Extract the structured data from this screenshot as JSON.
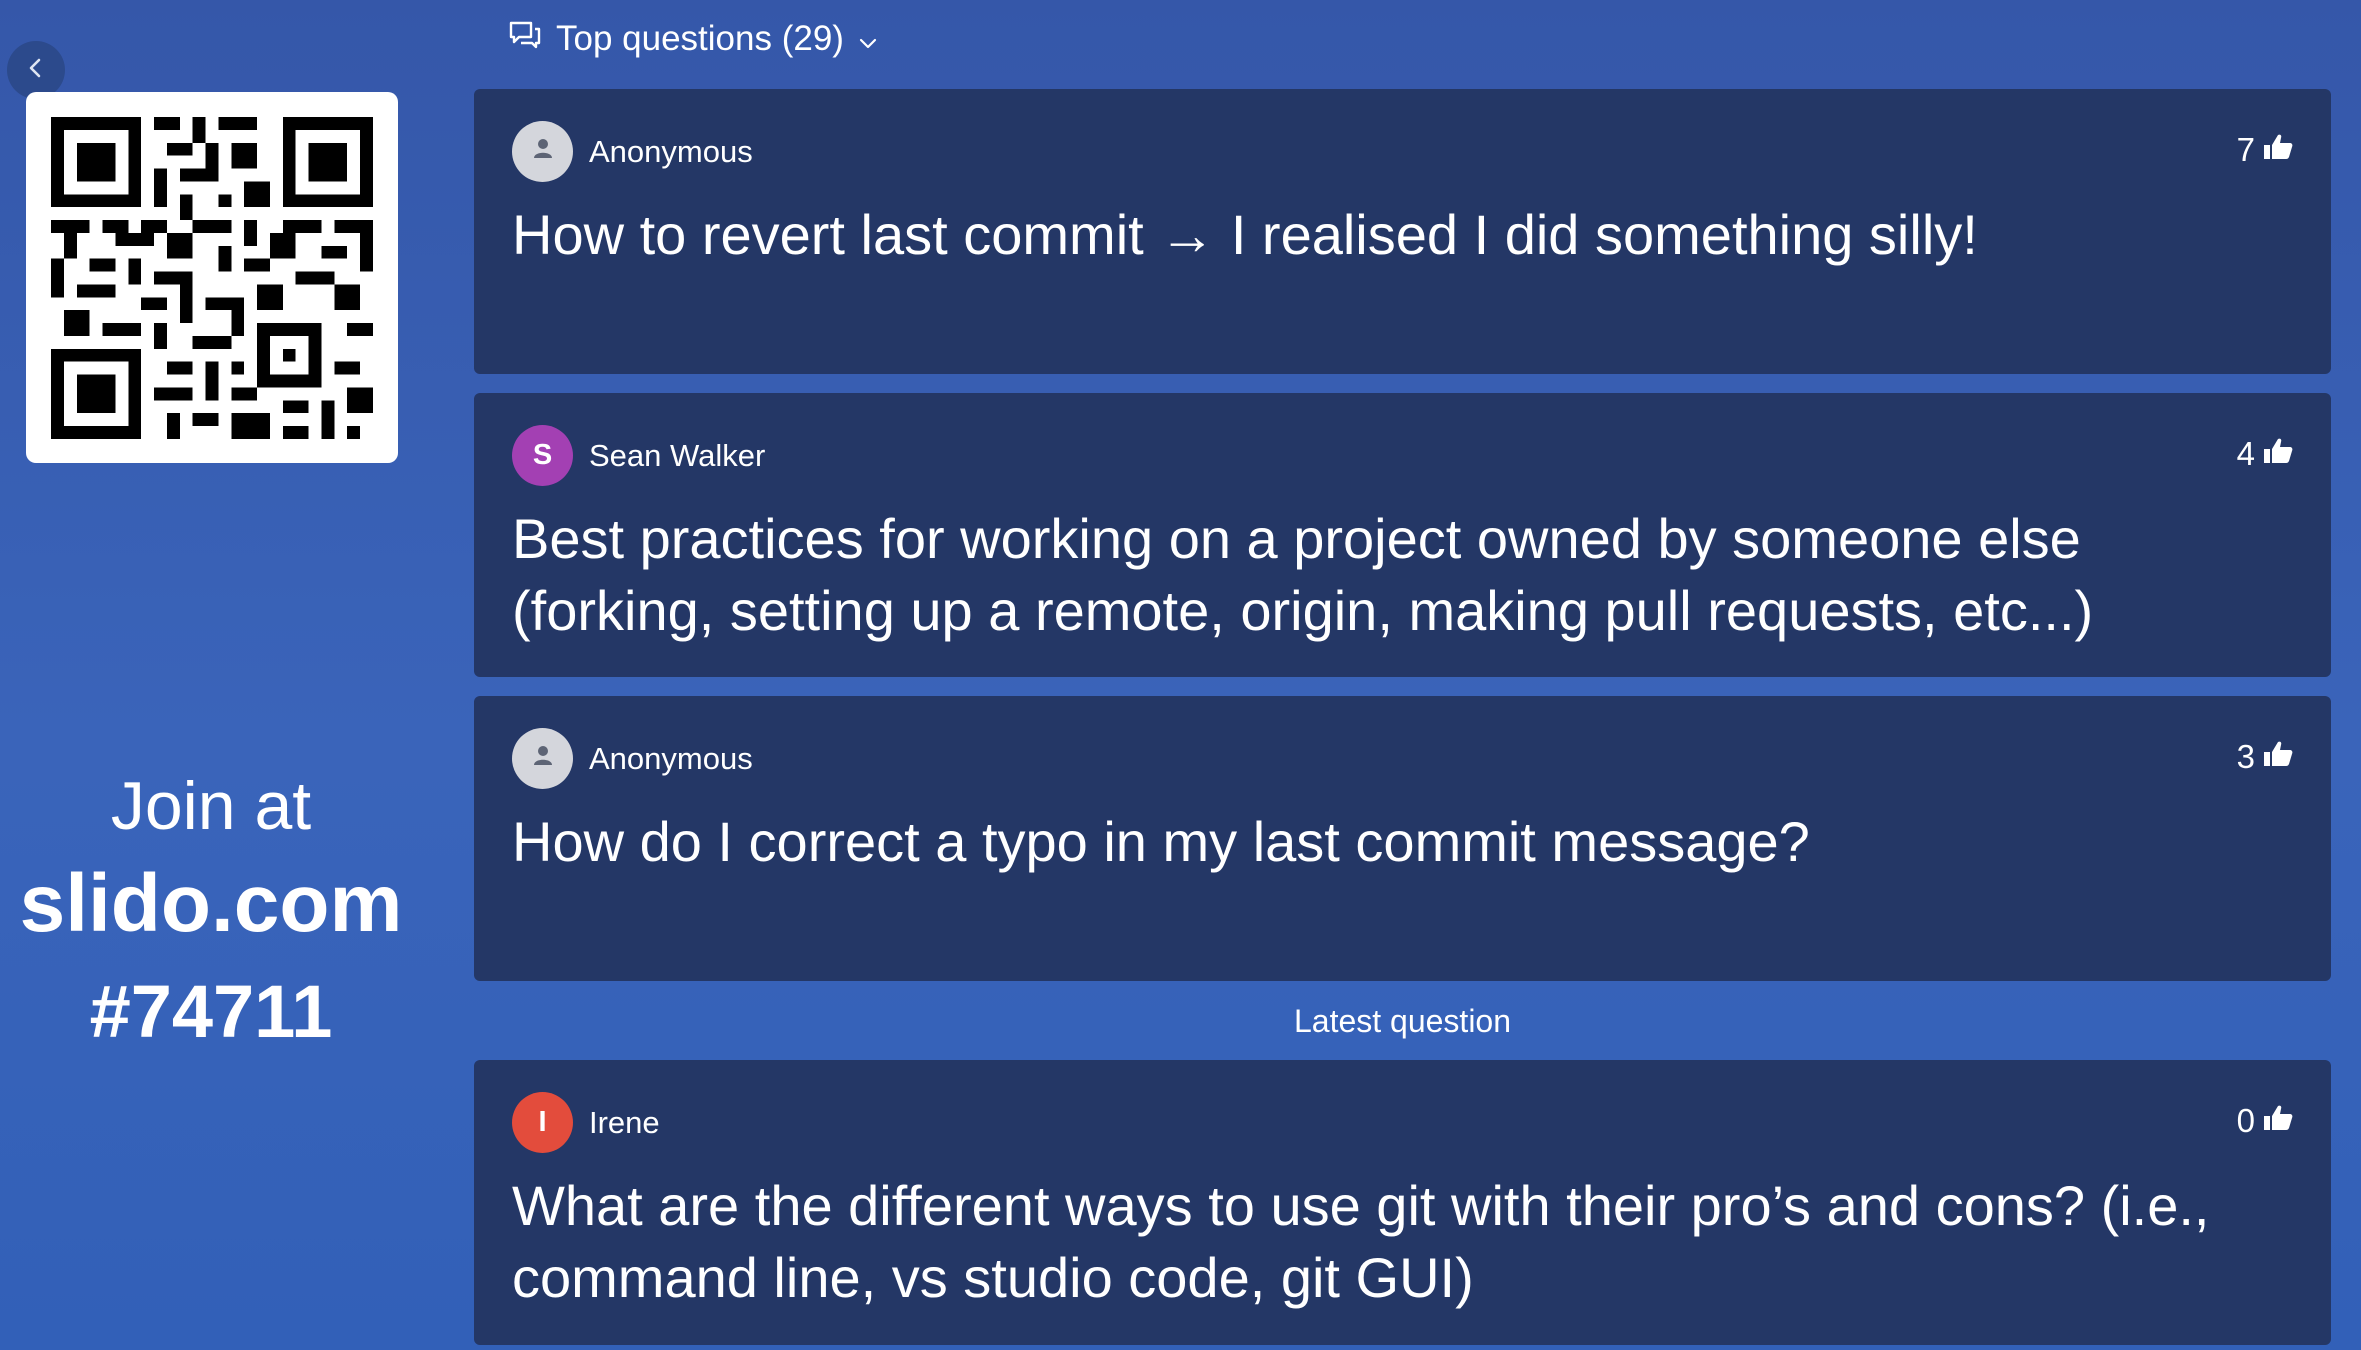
{
  "sidebar": {
    "join_label": "Join at",
    "join_site": "slido.com",
    "join_code": "#74711",
    "collapse_icon": "chevron-left-icon"
  },
  "header": {
    "title": "Top questions (29)",
    "icon": "chat-bubbles-icon",
    "dropdown_icon": "chevron-down-icon"
  },
  "colors": {
    "background": "#3557a9",
    "card": "#243766",
    "avatar_anonymous": "#d4d6dc",
    "avatar_sean": "#a340b3",
    "avatar_irene": "#e34c3c"
  },
  "questions": [
    {
      "author": "Anonymous",
      "initial": "",
      "likes": "7",
      "text": "How to revert last commit → I realised I did something silly!"
    },
    {
      "author": "Sean Walker",
      "initial": "S",
      "likes": "4",
      "text": "Best practices for working on a project owned by someone else (forking, setting up a remote, origin, making pull requests, etc...)"
    },
    {
      "author": "Anonymous",
      "initial": "",
      "likes": "3",
      "text": "How do I correct a typo in my last commit message?"
    }
  ],
  "latest_label": "Latest question",
  "latest": {
    "author": "Irene",
    "initial": "I",
    "likes": "0",
    "text": "What are the different ways to use git with their pro’s and cons? (i.e., command line, vs studio code, git GUI)"
  }
}
